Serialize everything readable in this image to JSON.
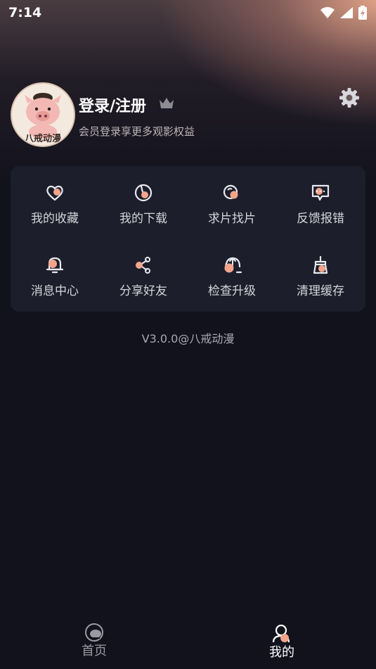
{
  "status_bar": {
    "time": "7:14"
  },
  "profile": {
    "avatar_text": "八戒动漫",
    "login_label": "登录/注册",
    "subtitle": "会员登录享更多观影权益"
  },
  "menu": {
    "items": [
      {
        "label": "我的收藏",
        "icon": "heart-icon"
      },
      {
        "label": "我的下载",
        "icon": "download-icon"
      },
      {
        "label": "求片找片",
        "icon": "search-film-icon"
      },
      {
        "label": "反馈报错",
        "icon": "feedback-icon"
      },
      {
        "label": "消息中心",
        "icon": "bell-icon"
      },
      {
        "label": "分享好友",
        "icon": "share-icon"
      },
      {
        "label": "检查升级",
        "icon": "upgrade-icon"
      },
      {
        "label": "清理缓存",
        "icon": "broom-icon"
      }
    ]
  },
  "version": "V3.0.0@八戒动漫",
  "bottom_nav": {
    "home_label": "首页",
    "mine_label": "我的"
  },
  "colors": {
    "background": "#12121d",
    "card": "#1c1e2b",
    "accent": "#f3a48b",
    "icon": "#e8e8ee"
  }
}
